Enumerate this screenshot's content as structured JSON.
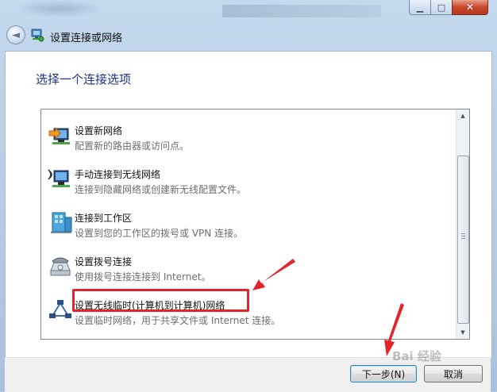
{
  "window": {
    "title": "设置连接或网络",
    "controls": {
      "minimize_glyph": "▁",
      "maximize_glyph": "□",
      "close_glyph": "✕"
    }
  },
  "nav": {
    "back_glyph": "◄"
  },
  "heading": "选择一个连接选项",
  "options": [
    {
      "title": "设置新网络",
      "description": "配置新的路由器或访问点。",
      "icon": "new-network-icon"
    },
    {
      "title": "手动连接到无线网络",
      "description": "连接到隐藏网络或创建新无线配置文件。",
      "icon": "wireless-manual-icon"
    },
    {
      "title": "连接到工作区",
      "description": "设置到您的工作区的拨号或 VPN 连接。",
      "icon": "workplace-icon"
    },
    {
      "title": "设置拨号连接",
      "description": "使用拨号连接连接到 Internet。",
      "icon": "dialup-phone-icon"
    },
    {
      "title": "设置无线临时(计算机到计算机)网络",
      "description": "设置临时网络，用于共享文件或 Internet 连接。",
      "icon": "adhoc-network-icon"
    }
  ],
  "buttons": {
    "next": "下一步(N)",
    "cancel": "取消"
  },
  "watermark": "Bai 经验",
  "colors": {
    "heading": "#1e3287",
    "annotation": "#e3242b",
    "next_button_border": "#3c7fb1"
  }
}
